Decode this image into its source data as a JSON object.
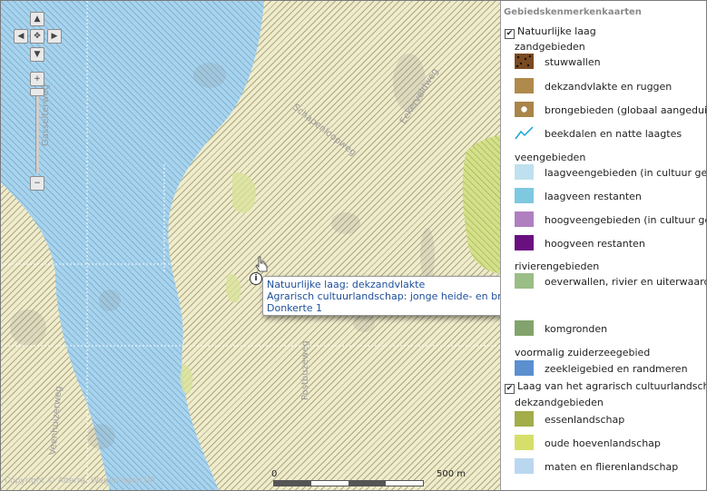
{
  "map": {
    "road_labels": [
      "Schapenloopweg",
      "Eekerveldweg",
      "Postbuzeweg",
      "Veenhuizerweg",
      "Gasselterweg"
    ],
    "copyright": "Copyright © Alterra, Wageningen UR",
    "scale": {
      "start": "0",
      "end": "500 m"
    },
    "tooltip": {
      "lines": [
        "Natuurlijke laag: dekzandvlakte",
        "Agrarisch cultuurlandschap: jonge heide- en broekontginningslandschap",
        "Donkerte 1"
      ]
    },
    "controls": {
      "pan_up": "▲",
      "pan_down": "▼",
      "pan_left": "◀",
      "pan_right": "▶",
      "center": "✥",
      "zoom_in": "+",
      "zoom_out": "−"
    }
  },
  "legend": {
    "title": "Gebiedskenmerkenkaarten",
    "layers": [
      {
        "label": "Natuurlijke laag",
        "checked": "✔",
        "groups": [
          {
            "heading": "zandgebieden",
            "items": [
              {
                "label": "stuwwallen",
                "color": "#7a4a22",
                "icon": "stuwwal-pattern-icon"
              },
              {
                "label": "dekzandvlakte en ruggen",
                "color": "#b08a4c",
                "icon": "solid-swatch"
              },
              {
                "label": "brongebieden (globaal aangeduid)",
                "color": "#a9854a",
                "icon": "spring-dot-icon"
              },
              {
                "label": "beekdalen en natte laagtes",
                "color": "#1aa3d8",
                "icon": "stream-line-icon"
              }
            ]
          },
          {
            "heading": "veengebieden",
            "items": [
              {
                "label": "laagveengebieden (in cultuur gebracht)",
                "color": "#bfe0ee",
                "icon": "solid-swatch"
              },
              {
                "label": "laagveen restanten",
                "color": "#7ec8e0",
                "icon": "solid-swatch"
              },
              {
                "label": "hoogveengebieden (in cultuur gebracht)",
                "color": "#b07fc0",
                "icon": "solid-swatch"
              },
              {
                "label": "hoogveen restanten",
                "color": "#6a0f80",
                "icon": "solid-swatch"
              }
            ]
          },
          {
            "heading": "rivierengebieden",
            "items": [
              {
                "label": "oeverwallen, rivier en uiterwaarden",
                "color": "#9bbd86",
                "icon": "solid-swatch"
              },
              {
                "label": "komgronden",
                "color": "#83a36c",
                "icon": "solid-swatch"
              }
            ]
          },
          {
            "heading": "voormalig zuiderzeegebied",
            "items": [
              {
                "label": "zeekleigebied en randmeren",
                "color": "#5b8fcf",
                "icon": "solid-swatch"
              }
            ]
          }
        ]
      },
      {
        "label": "Laag van het agrarisch cultuurlandschap",
        "checked": "✔",
        "groups": [
          {
            "heading": "dekzandgebieden",
            "items": [
              {
                "label": "essenlandschap",
                "color": "#a3ad4a",
                "icon": "solid-swatch"
              },
              {
                "label": "oude hoevenlandschap",
                "color": "#d6df6a",
                "icon": "solid-swatch"
              },
              {
                "label": "maten en flierenlandschap",
                "color": "#bad7f0",
                "icon": "solid-swatch"
              }
            ]
          }
        ]
      }
    ]
  }
}
